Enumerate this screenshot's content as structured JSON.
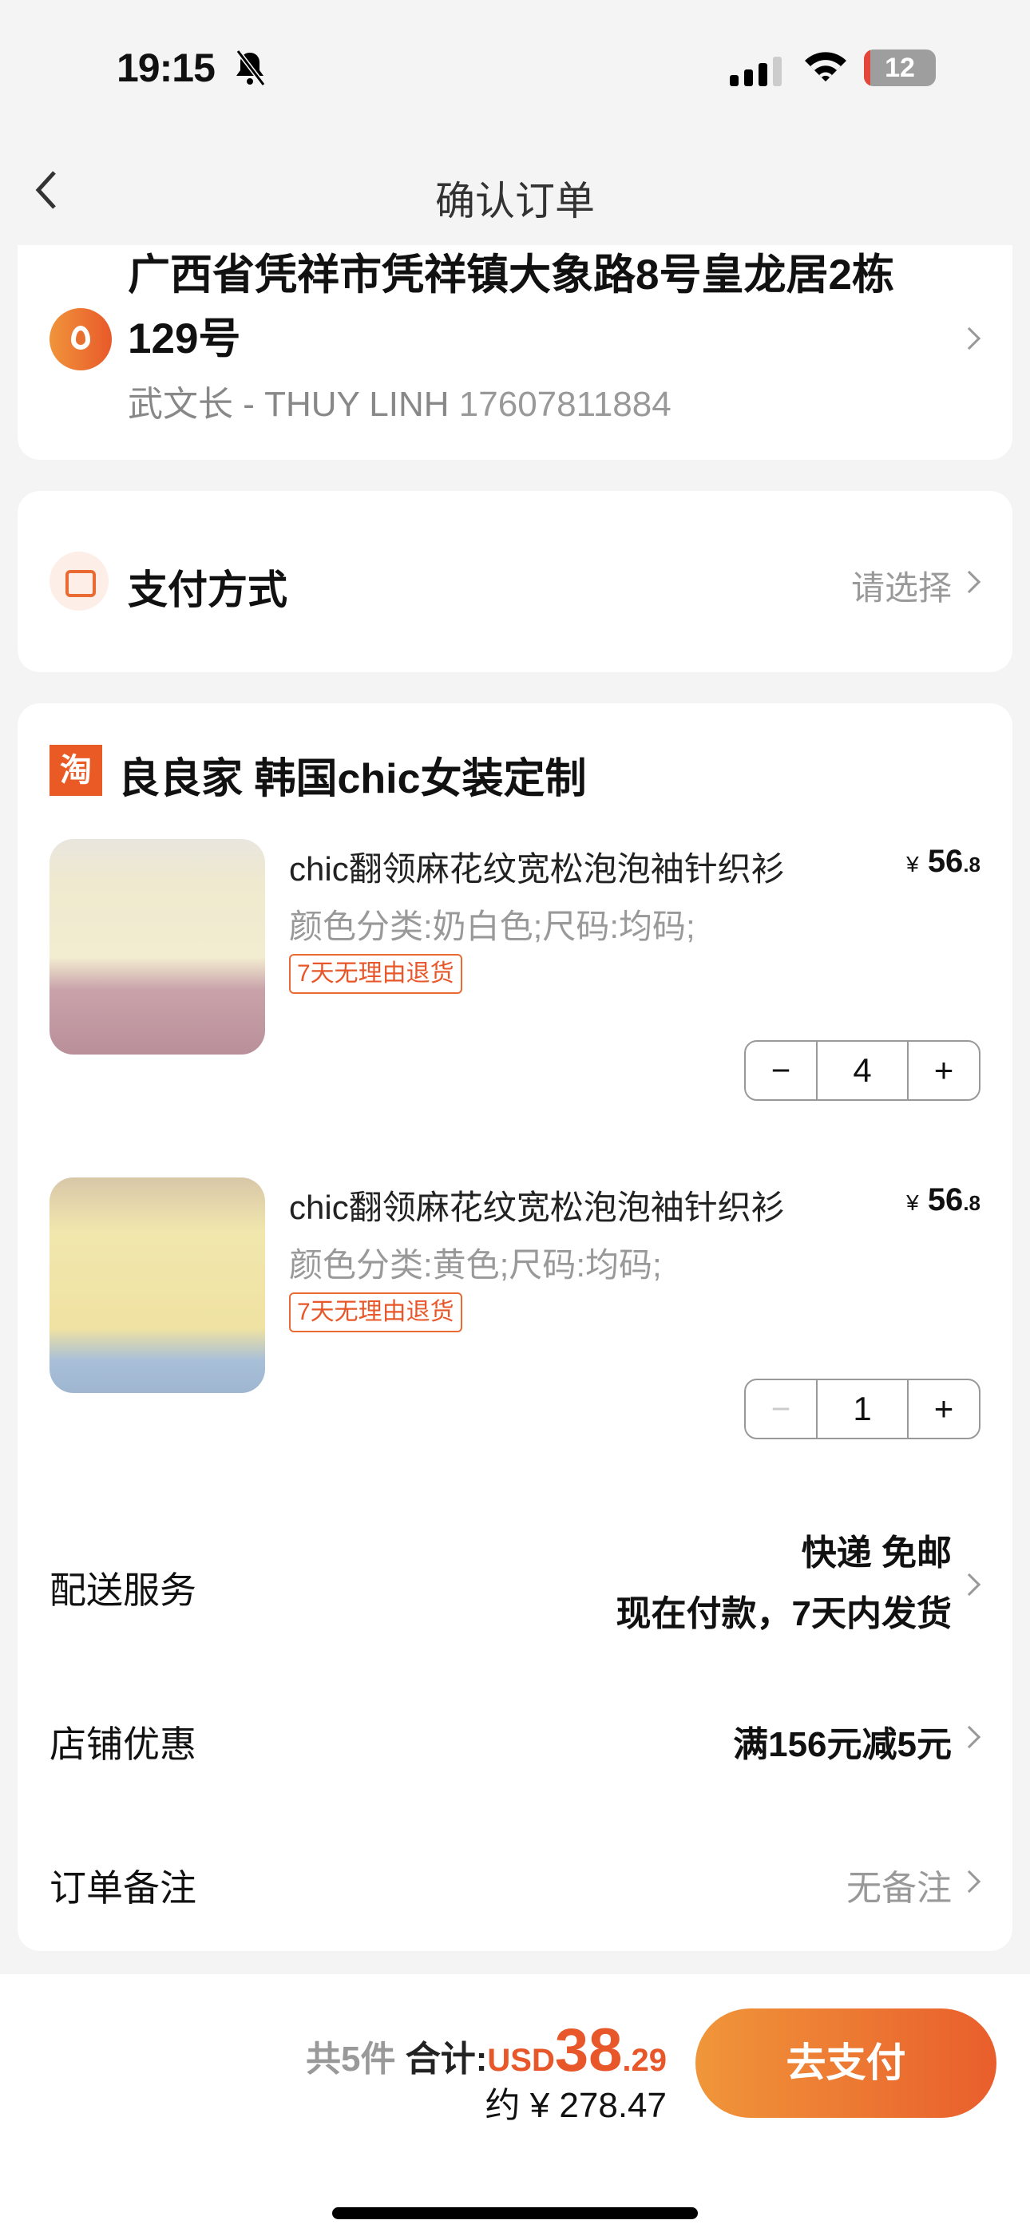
{
  "status_bar": {
    "time": "19:15",
    "battery": "12",
    "icons": [
      "bell-slash-icon",
      "signal-icon",
      "wifi-icon",
      "battery-icon"
    ]
  },
  "nav": {
    "title": "确认订单"
  },
  "address": {
    "line": "广西省凭祥市凭祥镇大象路8号皇龙居2栋129号",
    "name": "武文长 - THUY LINH",
    "phone": "17607811884"
  },
  "payment": {
    "label": "支付方式",
    "value": "请选择"
  },
  "shop": {
    "logo": "淘",
    "name": "良良家 韩国chic女装定制",
    "items": [
      {
        "title": "chic翻领麻花纹宽松泡泡袖针织衫",
        "price_yen": "¥",
        "price_int": "56",
        "price_dec": ".8",
        "spec": "颜色分类:奶白色;尺码:均码;",
        "tag": "7天无理由退货",
        "qty": "4"
      },
      {
        "title": "chic翻领麻花纹宽松泡泡袖针织衫",
        "price_yen": "¥",
        "price_int": "56",
        "price_dec": ".8",
        "spec": "颜色分类:黄色;尺码:均码;",
        "tag": "7天无理由退货",
        "qty": "1"
      }
    ],
    "stepper": {
      "minus": "−",
      "plus": "+"
    },
    "delivery": {
      "label": "配送服务",
      "line1": "快递 免邮",
      "line2": "现在付款，7天内发货"
    },
    "discount": {
      "label": "店铺优惠",
      "value": "满156元减5元"
    },
    "note": {
      "label": "订单备注",
      "value": "无备注"
    }
  },
  "footer": {
    "count": "共5件",
    "total_label": "合计:",
    "currency": "USD",
    "amount_int": "38",
    "amount_dec": ".29",
    "approx": "约 ¥ 278.47",
    "pay_button": "去支付"
  },
  "colors": {
    "accent": "#e8572a",
    "gradient_start": "#f0963a",
    "gradient_end": "#e95e2c"
  }
}
